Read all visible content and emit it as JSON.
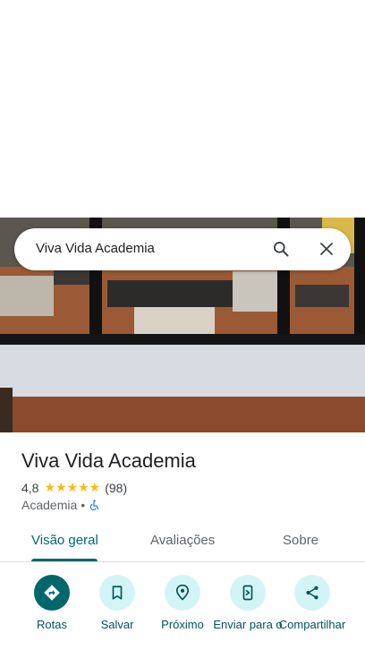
{
  "search": {
    "query": "Viva Vida Academia"
  },
  "place": {
    "name": "Viva Vida Academia",
    "rating": "4,8",
    "stars": "★★★★★",
    "reviews": "(98)",
    "category": "Academia",
    "separator": "•"
  },
  "tabs": [
    {
      "label": "Visão geral",
      "active": true
    },
    {
      "label": "Avaliações",
      "active": false
    },
    {
      "label": "Sobre",
      "active": false
    }
  ],
  "actions": [
    {
      "label": "Rotas",
      "icon": "directions-icon"
    },
    {
      "label": "Salvar",
      "icon": "bookmark-icon"
    },
    {
      "label": "Próximo",
      "icon": "nearby-icon"
    },
    {
      "label": "Enviar para o",
      "icon": "send-to-phone-icon"
    },
    {
      "label": "Compartilhar",
      "icon": "share-icon"
    }
  ],
  "colors": {
    "accent": "#00676d",
    "accent_light": "#d3f4f6",
    "star": "#fbbc04"
  }
}
